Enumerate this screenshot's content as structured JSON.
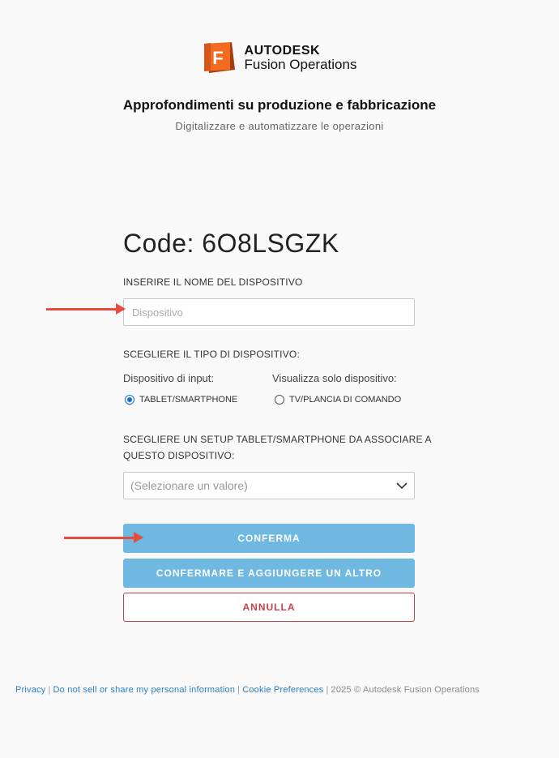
{
  "header": {
    "brand": "AUTODESK",
    "product": "Fusion Operations",
    "logo_letter": "F",
    "title": "Approfondimenti su produzione e fabbricazione",
    "subtitle": "Digitalizzare e automatizzare le operazioni"
  },
  "form": {
    "code": "Code: 6O8LSGZK",
    "device_name_label": "INSERIRE IL NOME DEL DISPOSITIVO",
    "device_name_placeholder": "Dispositivo",
    "device_name_value": "",
    "device_type_label": "SCEGLIERE IL TIPO DI DISPOSITIVO:",
    "input_device_label": "Dispositivo di input:",
    "view_only_label": "Visualizza solo dispositivo:",
    "radio_tablet": "TABLET/SMARTPHONE",
    "radio_tv": "TV/PLANCIA DI COMANDO",
    "selected_type": "TABLET/SMARTPHONE",
    "setup_label_line1": "SCEGLIERE UN SETUP TABLET/SMARTPHONE DA ASSOCIARE A",
    "setup_label_line2": "QUESTO DISPOSITIVO:",
    "setup_placeholder": "(Selezionare un valore)",
    "confirm": "CONFERMA",
    "confirm_add": "CONFERMARE E AGGIUNGERE UN ALTRO",
    "cancel": "ANNULLA"
  },
  "footer": {
    "privacy": "Privacy",
    "do_not_sell": "Do not sell or share my personal information",
    "cookie": "Cookie Preferences",
    "copyright": "2025 © Autodesk Fusion Operations",
    "separator": "|"
  },
  "colors": {
    "primary_button": "#6fb8e2",
    "cancel": "#c8414a",
    "link": "#2a7fc4",
    "logo_orange": "#f26b21",
    "annotation_arrow": "#e74c3c"
  },
  "icons": [
    "fusion-logo-icon",
    "chevron-down-icon",
    "red-annotation-arrow"
  ]
}
